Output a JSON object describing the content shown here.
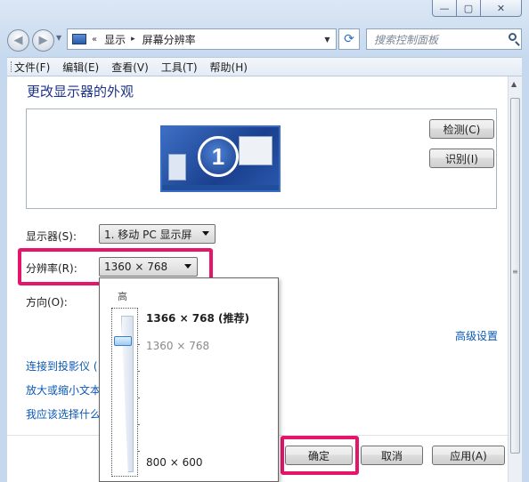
{
  "window": {
    "caption_buttons": {
      "min": "—",
      "max": "▢",
      "close": "✕"
    }
  },
  "nav": {
    "back_icon": "◀",
    "forward_icon": "▶",
    "dropdown": "▼",
    "address_chevron": "«",
    "breadcrumbs": [
      "显示",
      "屏幕分辨率"
    ],
    "crumb_separator": "▸",
    "address_dropdown": "▼",
    "refresh_icon": "⟳",
    "search_placeholder": "搜索控制面板"
  },
  "menubar": {
    "items": [
      "文件(F)",
      "编辑(E)",
      "查看(V)",
      "工具(T)",
      "帮助(H)"
    ]
  },
  "main": {
    "title": "更改显示器的外观",
    "monitor_number": "1",
    "detect_button": "检测(C)",
    "identify_button": "识别(I)",
    "display_label": "显示器(S):",
    "display_value": "1. 移动 PC 显示屏",
    "resolution_label": "分辨率(R):",
    "resolution_value": "1360 × 768",
    "orientation_label": "方向(O):",
    "advanced_link": "高级设置",
    "links": [
      "连接到投影仪 (",
      "放大或缩小文本",
      "我应该选择什么"
    ],
    "ok_button": "确定",
    "cancel_button": "取消",
    "apply_button": "应用(A)"
  },
  "resolution_popup": {
    "high_label": "高",
    "recommended": "1366 × 768 (推荐)",
    "current": "1360 × 768",
    "lowest": "800 × 600",
    "slider_position_fraction": 0.13
  },
  "colors": {
    "highlight": "#e5156c",
    "link": "#0b58b5",
    "title": "#1e3287"
  }
}
